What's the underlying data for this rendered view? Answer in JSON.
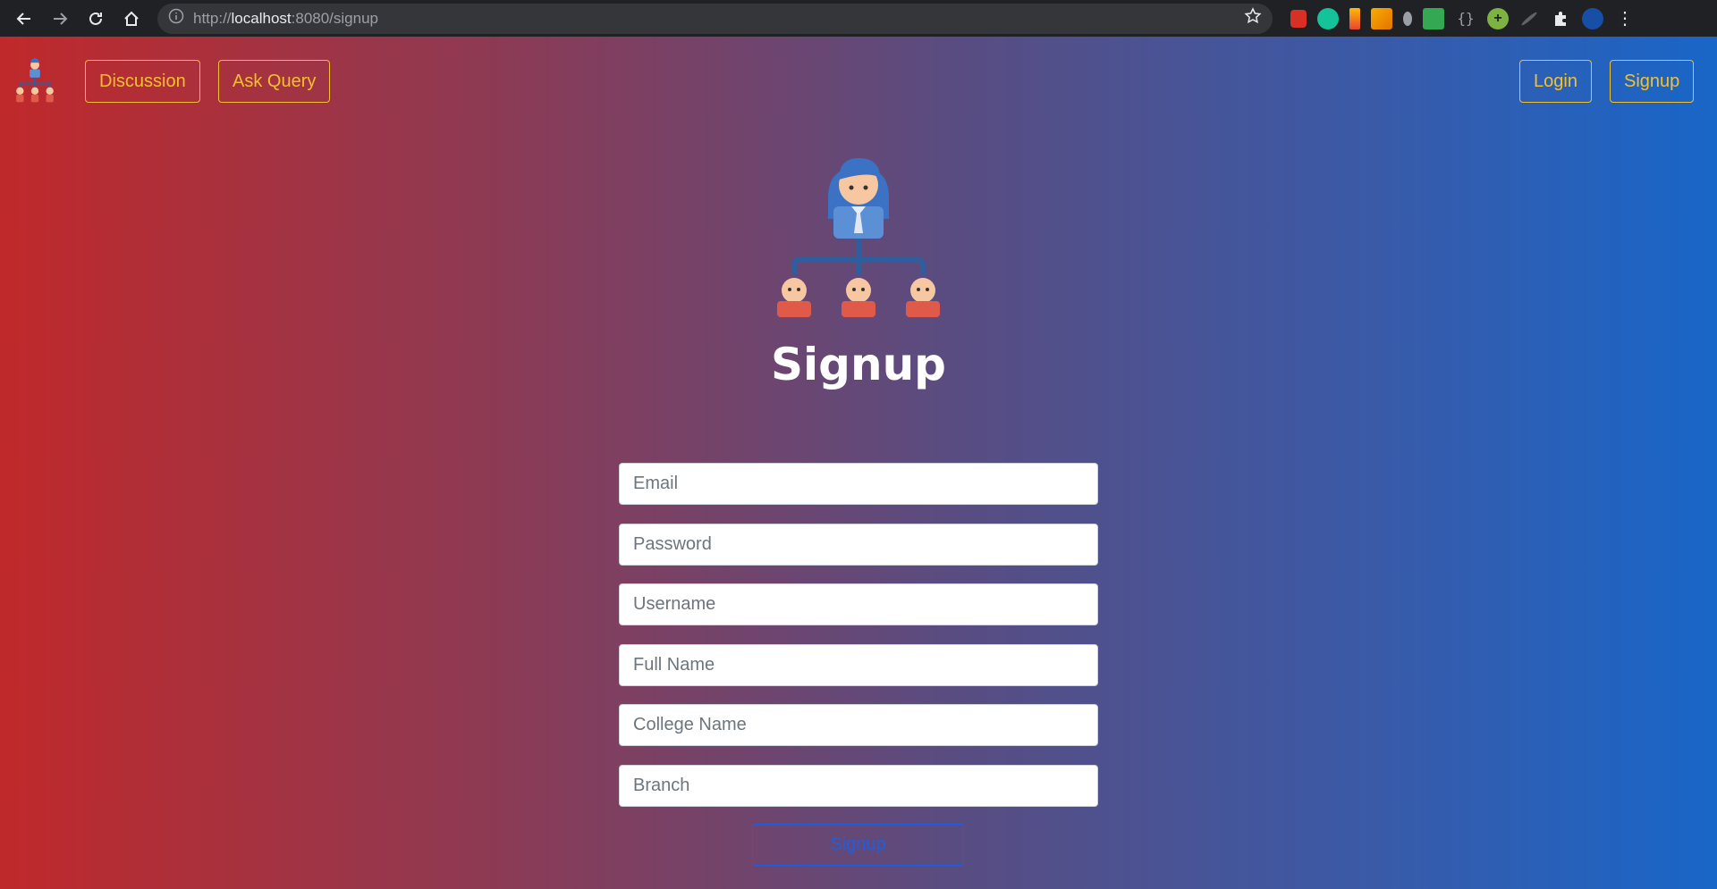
{
  "browser": {
    "url_prefix": "http://",
    "url_host": "localhost",
    "url_rest": ":8080/signup"
  },
  "navbar": {
    "discussion_label": "Discussion",
    "ask_query_label": "Ask Query",
    "login_label": "Login",
    "signup_label": "Signup"
  },
  "main": {
    "title": "Signup",
    "fields": {
      "email_placeholder": "Email",
      "password_placeholder": "Password",
      "username_placeholder": "Username",
      "fullname_placeholder": "Full Name",
      "college_placeholder": "College Name",
      "branch_placeholder": "Branch"
    },
    "submit_label": "Signup"
  },
  "colors": {
    "accent_outline": "#f5c02d",
    "submit_outline": "#1d5fe0",
    "gradient_left": "#c0292b",
    "gradient_right": "#1866c8"
  },
  "icons": {
    "brand": "org-hierarchy-icon",
    "hero": "org-hierarchy-icon"
  }
}
